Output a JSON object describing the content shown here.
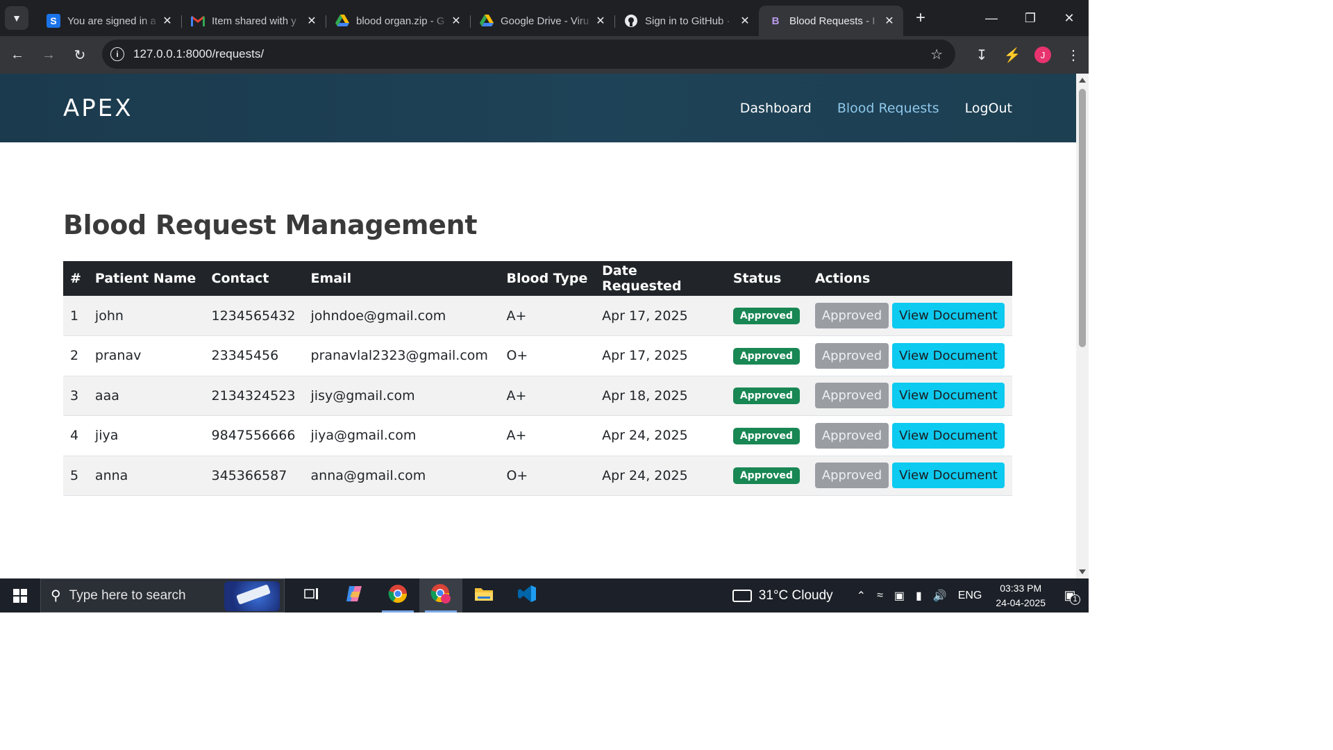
{
  "browser": {
    "tabs": [
      {
        "title": "You are signed in a",
        "icon": "s-icon",
        "active": false
      },
      {
        "title": "Item shared with y",
        "icon": "gmail-icon",
        "active": false
      },
      {
        "title": "blood organ.zip - G",
        "icon": "google-drive-icon",
        "active": false
      },
      {
        "title": "Google Drive - Viru",
        "icon": "google-drive-icon",
        "active": false
      },
      {
        "title": "Sign in to GitHub ·",
        "icon": "github-icon",
        "active": false
      },
      {
        "title": "Blood Requests - I",
        "icon": "bootstrap-icon",
        "active": true
      }
    ],
    "url": "127.0.0.1:8000/requests/",
    "profile_initial": "J"
  },
  "site": {
    "brand": "APEX",
    "nav": [
      {
        "label": "Dashboard",
        "active": false
      },
      {
        "label": "Blood Requests",
        "active": true
      },
      {
        "label": "LogOut",
        "active": false
      }
    ]
  },
  "page": {
    "title": "Blood Request Management"
  },
  "table": {
    "headers": [
      "#",
      "Patient Name",
      "Contact",
      "Email",
      "Blood Type",
      "Date Requested",
      "Status",
      "Actions"
    ],
    "rows": [
      {
        "num": "1",
        "name": "john",
        "contact": "1234565432",
        "email": "johndoe@gmail.com",
        "blood_type": "A+",
        "date": "Apr 17, 2025",
        "status": "Approved",
        "action_label": "Approved",
        "view_label": "View Document"
      },
      {
        "num": "2",
        "name": "pranav",
        "contact": "23345456",
        "email": "pranavlal2323@gmail.com",
        "blood_type": "O+",
        "date": "Apr 17, 2025",
        "status": "Approved",
        "action_label": "Approved",
        "view_label": "View Document"
      },
      {
        "num": "3",
        "name": "aaa",
        "contact": "2134324523",
        "email": "jisy@gmail.com",
        "blood_type": "A+",
        "date": "Apr 18, 2025",
        "status": "Approved",
        "action_label": "Approved",
        "view_label": "View Document"
      },
      {
        "num": "4",
        "name": "jiya",
        "contact": "9847556666",
        "email": "jiya@gmail.com",
        "blood_type": "A+",
        "date": "Apr 24, 2025",
        "status": "Approved",
        "action_label": "Approved",
        "view_label": "View Document"
      },
      {
        "num": "5",
        "name": "anna",
        "contact": "345366587",
        "email": "anna@gmail.com",
        "blood_type": "O+",
        "date": "Apr 24, 2025",
        "status": "Approved",
        "action_label": "Approved",
        "view_label": "View Document"
      }
    ]
  },
  "taskbar": {
    "search_placeholder": "Type here to search",
    "weather": "31°C  Cloudy",
    "language": "ENG",
    "time": "03:33 PM",
    "date": "24-04-2025",
    "notification_count": "1"
  },
  "colors": {
    "nav_bg": "#1e4257",
    "nav_active": "#8ec7ea",
    "table_header_bg": "#212529",
    "status_approved": "#198754",
    "btn_approved": "#9a9ea3",
    "btn_view": "#0dcaf0"
  }
}
